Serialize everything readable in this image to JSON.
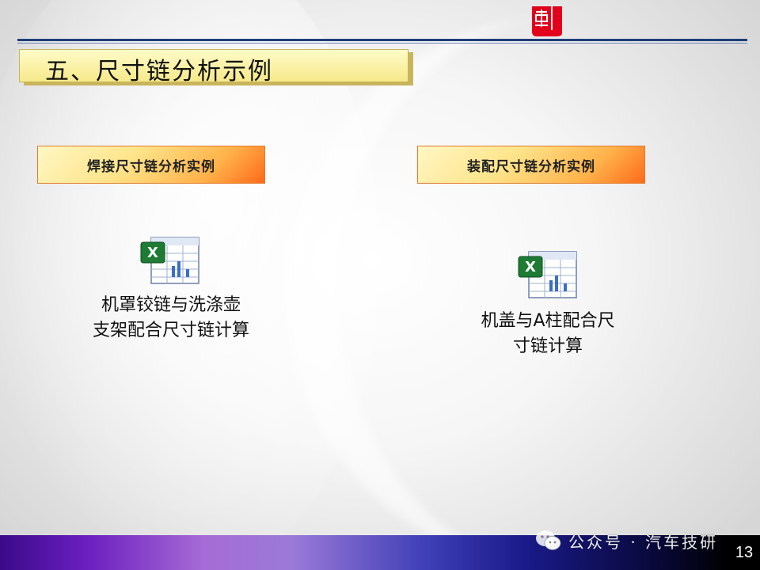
{
  "slide": {
    "title": "五、尺寸链分析示例",
    "page_number": "13"
  },
  "sections": [
    {
      "heading": "焊接尺寸链分析实例",
      "icon": "excel-spreadsheet-icon",
      "caption_line1": "机罩铰链与洗涤壶",
      "caption_line2": "支架配合尺寸链计算"
    },
    {
      "heading": "装配尺寸链分析实例",
      "icon": "excel-spreadsheet-icon",
      "caption_line1": "机盖与A柱配合尺",
      "caption_line2": "寸链计算"
    }
  ],
  "watermark": {
    "icon": "wechat-icon",
    "text": "公众号 · 汽车技研"
  },
  "colors": {
    "title_fill": "#f6e98a",
    "header_rule": "#1f3f7a",
    "button_gradient_end": "#ff6a1a",
    "logo_red": "#e2001a"
  }
}
